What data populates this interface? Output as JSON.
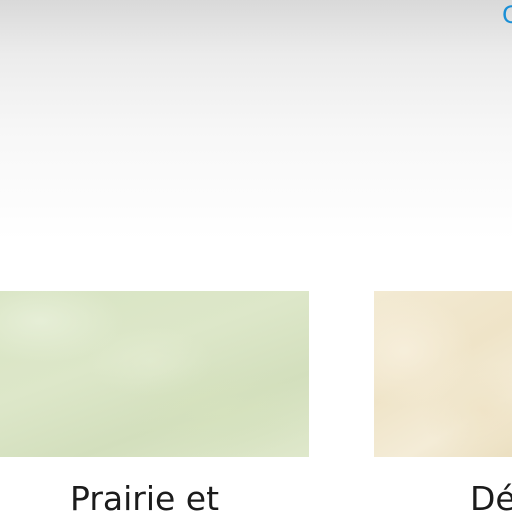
{
  "header": {
    "corner_link": "C"
  },
  "cards": [
    {
      "label": "Prairie et",
      "thumbnail": "grassland-thumbnail"
    },
    {
      "label": "Dé",
      "thumbnail": "desert-thumbnail"
    }
  ],
  "colors": {
    "link": "#1a8fd6",
    "prairie": "#d8e4c3",
    "desert": "#f3ead3"
  }
}
